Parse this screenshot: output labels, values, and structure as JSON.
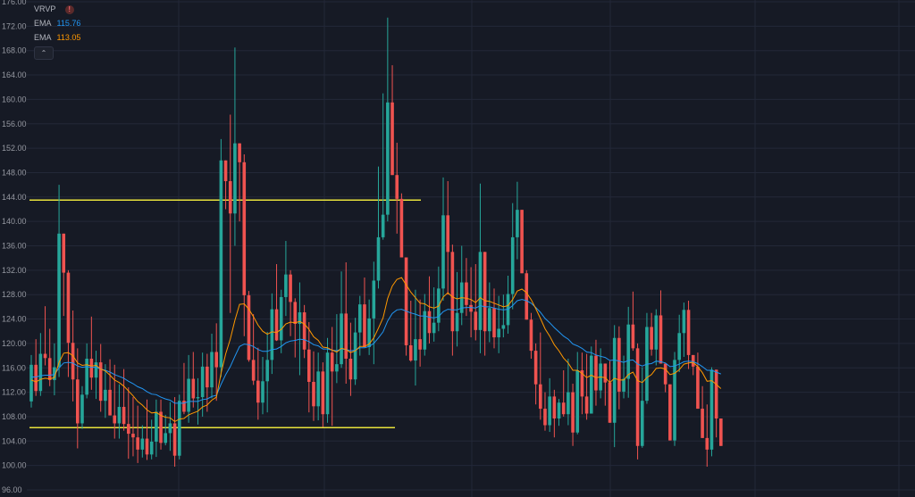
{
  "legend": {
    "vrvp_label": "VRVP",
    "warning_glyph": "!",
    "ema1_label": "EMA",
    "ema1_value": "115.76",
    "ema1_color": "#2196f3",
    "ema2_label": "EMA",
    "ema2_value": "113.05",
    "ema2_color": "#ff9800",
    "collapse_glyph": "⌃"
  },
  "colors": {
    "background": "#161a25",
    "grid": "#232838",
    "up": "#26a69a",
    "down": "#ef5350",
    "level_lines": "#e8e23c",
    "axis_text": "#9598a1"
  },
  "chart_data": {
    "type": "candlestick",
    "title": "",
    "ylim": [
      96,
      176
    ],
    "yticks": [
      96.0,
      100.0,
      104.0,
      108.0,
      112.0,
      116.0,
      120.0,
      124.0,
      128.0,
      132.0,
      136.0,
      140.0,
      144.0,
      148.0,
      152.0,
      156.0,
      160.0,
      164.0,
      168.0,
      172.0,
      176.0
    ],
    "grid": true,
    "levels": [
      143.5,
      106.2
    ],
    "ohlc": [
      [
        110.5,
        118.1,
        109.5,
        116.5
      ],
      [
        116.5,
        120.7,
        111.4,
        112.2
      ],
      [
        112.2,
        121.7,
        111.4,
        118.3
      ],
      [
        118.3,
        126.1,
        116.4,
        117.6
      ],
      [
        117.6,
        122.4,
        113.0,
        114.0
      ],
      [
        114.0,
        120.0,
        111.5,
        116.1
      ],
      [
        116.1,
        146.0,
        114.5,
        138.0
      ],
      [
        138.0,
        136.2,
        124.5,
        131.6
      ],
      [
        131.6,
        132.0,
        114.5,
        120.1
      ],
      [
        120.1,
        125.4,
        110.5,
        114.1
      ],
      [
        114.1,
        119.2,
        102.8,
        106.9
      ],
      [
        106.9,
        113.0,
        106.0,
        111.6
      ],
      [
        111.6,
        120.0,
        111.0,
        117.5
      ],
      [
        117.5,
        124.4,
        112.4,
        114.4
      ],
      [
        114.4,
        118.8,
        110.9,
        116.9
      ],
      [
        116.9,
        119.9,
        108.8,
        110.6
      ],
      [
        110.6,
        116.6,
        107.8,
        112.4
      ],
      [
        112.4,
        117.4,
        108.2,
        108.2
      ],
      [
        108.2,
        116.5,
        104.4,
        106.9
      ],
      [
        106.9,
        113.3,
        104.4,
        109.6
      ],
      [
        109.6,
        115.8,
        105.7,
        106.8
      ],
      [
        106.8,
        112.8,
        101.1,
        105.2
      ],
      [
        105.2,
        111.2,
        101.5,
        104.6
      ],
      [
        104.6,
        109.8,
        100.4,
        102.6
      ],
      [
        102.6,
        106.6,
        101.3,
        104.4
      ],
      [
        104.4,
        110.8,
        100.9,
        101.8
      ],
      [
        101.8,
        107.5,
        101.0,
        103.9
      ],
      [
        103.9,
        110.8,
        101.4,
        108.8
      ],
      [
        108.8,
        110.8,
        102.6,
        103.7
      ],
      [
        103.7,
        108.3,
        103.3,
        105.3
      ],
      [
        105.3,
        110.4,
        102.4,
        106.9
      ],
      [
        106.9,
        111.2,
        99.8,
        101.6
      ],
      [
        101.6,
        111.6,
        101.0,
        110.6
      ],
      [
        110.6,
        116.8,
        108.4,
        108.8
      ],
      [
        108.8,
        118.1,
        107.0,
        114.2
      ],
      [
        114.2,
        118.6,
        109.5,
        111.0
      ],
      [
        111.0,
        114.3,
        106.7,
        111.2
      ],
      [
        111.2,
        118.5,
        108.0,
        116.2
      ],
      [
        116.2,
        118.3,
        108.8,
        112.8
      ],
      [
        112.8,
        121.6,
        111.0,
        118.6
      ],
      [
        118.6,
        123.3,
        110.6,
        116.1
      ],
      [
        116.1,
        153.5,
        114.5,
        150.0
      ],
      [
        150.0,
        148.8,
        142.0,
        146.6
      ],
      [
        146.6,
        157.5,
        125.0,
        141.3
      ],
      [
        141.3,
        168.5,
        136.0,
        152.8
      ],
      [
        152.8,
        152.1,
        140.0,
        149.7
      ],
      [
        149.7,
        151.0,
        121.2,
        127.9
      ],
      [
        127.9,
        128.6,
        117.0,
        117.3
      ],
      [
        117.3,
        124.8,
        113.2,
        113.9
      ],
      [
        113.9,
        119.3,
        107.5,
        110.3
      ],
      [
        110.3,
        117.8,
        108.4,
        113.8
      ],
      [
        113.8,
        121.9,
        108.7,
        117.3
      ],
      [
        117.3,
        128.2,
        115.0,
        125.6
      ],
      [
        125.6,
        133.0,
        120.4,
        120.5
      ],
      [
        120.5,
        128.8,
        118.4,
        127.6
      ],
      [
        127.6,
        136.8,
        124.5,
        131.3
      ],
      [
        131.3,
        132.0,
        121.2,
        126.8
      ],
      [
        126.8,
        127.4,
        117.7,
        123.2
      ],
      [
        123.2,
        130.0,
        114.8,
        125.1
      ],
      [
        125.1,
        126.3,
        117.6,
        119.0
      ],
      [
        119.0,
        123.5,
        108.7,
        113.7
      ],
      [
        113.7,
        118.7,
        107.3,
        109.7
      ],
      [
        109.7,
        118.5,
        107.4,
        115.4
      ],
      [
        115.4,
        116.9,
        106.3,
        108.4
      ],
      [
        108.4,
        120.9,
        107.0,
        118.5
      ],
      [
        118.5,
        122.7,
        106.5,
        115.4
      ],
      [
        115.4,
        124.8,
        113.5,
        116.6
      ],
      [
        116.6,
        131.8,
        116.0,
        124.9
      ],
      [
        124.9,
        133.3,
        113.4,
        117.5
      ],
      [
        117.5,
        123.4,
        111.4,
        114.1
      ],
      [
        114.1,
        124.2,
        113.2,
        121.8
      ],
      [
        121.8,
        127.8,
        118.0,
        126.4
      ],
      [
        126.4,
        130.8,
        121.2,
        119.4
      ],
      [
        119.4,
        127.2,
        118.1,
        124.1
      ],
      [
        124.1,
        133.4,
        116.6,
        130.3
      ],
      [
        130.3,
        149.0,
        129.0,
        137.4
      ],
      [
        137.4,
        161.0,
        137.0,
        141.1
      ],
      [
        141.1,
        173.4,
        140.0,
        159.5
      ],
      [
        159.5,
        165.6,
        147.8,
        147.6
      ],
      [
        147.6,
        152.9,
        138.0,
        143.7
      ],
      [
        143.7,
        144.6,
        135.7,
        134.1
      ],
      [
        134.1,
        133.7,
        118.0,
        119.7
      ],
      [
        119.7,
        127.0,
        117.0,
        117.2
      ],
      [
        117.2,
        128.8,
        113.1,
        120.7
      ],
      [
        120.7,
        127.2,
        116.2,
        119.0
      ],
      [
        119.0,
        128.1,
        118.0,
        125.3
      ],
      [
        125.3,
        131.0,
        120.0,
        121.7
      ],
      [
        121.7,
        129.2,
        120.3,
        123.4
      ],
      [
        123.4,
        132.6,
        122.0,
        129.0
      ],
      [
        129.0,
        147.2,
        127.0,
        141.0
      ],
      [
        141.0,
        146.6,
        128.0,
        135.0
      ],
      [
        135.0,
        136.2,
        118.0,
        122.0
      ],
      [
        122.0,
        131.7,
        119.5,
        125.0
      ],
      [
        125.0,
        136.0,
        123.0,
        130.0
      ],
      [
        130.0,
        134.0,
        124.5,
        126.3
      ],
      [
        126.3,
        132.5,
        121.0,
        125.2
      ],
      [
        125.2,
        133.0,
        120.5,
        122.2
      ],
      [
        122.2,
        146.2,
        118.4,
        135.0
      ],
      [
        135.0,
        131.0,
        118.0,
        122.0
      ],
      [
        122.0,
        130.0,
        120.2,
        125.8
      ],
      [
        125.8,
        129.0,
        119.2,
        121.0
      ],
      [
        121.0,
        127.8,
        118.4,
        122.4
      ],
      [
        122.4,
        128.0,
        121.0,
        123.0
      ],
      [
        123.0,
        131.1,
        121.6,
        128.1
      ],
      [
        128.1,
        143.0,
        125.6,
        137.4
      ],
      [
        137.4,
        146.5,
        133.8,
        141.9
      ],
      [
        141.9,
        141.3,
        136.1,
        131.5
      ],
      [
        131.5,
        132.0,
        124.0,
        123.9
      ],
      [
        123.9,
        125.0,
        117.5,
        118.8
      ],
      [
        118.8,
        120.0,
        110.0,
        113.3
      ],
      [
        113.3,
        121.8,
        107.5,
        109.3
      ],
      [
        109.3,
        112.0,
        105.7,
        106.6
      ],
      [
        106.6,
        114.3,
        105.5,
        111.3
      ],
      [
        111.3,
        112.4,
        104.6,
        107.7
      ],
      [
        107.7,
        110.9,
        106.5,
        110.3
      ],
      [
        110.3,
        115.6,
        108.0,
        108.4
      ],
      [
        108.4,
        117.5,
        106.6,
        112.0
      ],
      [
        112.0,
        113.4,
        103.2,
        105.4
      ],
      [
        105.4,
        118.6,
        105.1,
        115.6
      ],
      [
        115.6,
        118.5,
        108.4,
        111.3
      ],
      [
        111.3,
        118.3,
        107.5,
        108.5
      ],
      [
        108.5,
        119.5,
        108.5,
        118.0
      ],
      [
        118.0,
        120.6,
        109.8,
        112.3
      ],
      [
        112.3,
        119.2,
        111.0,
        116.7
      ],
      [
        116.7,
        116.4,
        109.8,
        113.6
      ],
      [
        113.6,
        117.1,
        108.0,
        107.0
      ],
      [
        107.0,
        123.0,
        103.0,
        120.9
      ],
      [
        120.9,
        122.8,
        109.2,
        112.1
      ],
      [
        112.1,
        118.0,
        111.0,
        114.2
      ],
      [
        114.2,
        126.0,
        111.1,
        123.1
      ],
      [
        123.1,
        128.5,
        118.8,
        119.2
      ],
      [
        119.2,
        120.0,
        101.0,
        103.2
      ],
      [
        103.2,
        116.1,
        102.9,
        110.6
      ],
      [
        110.6,
        125.0,
        110.1,
        122.7
      ],
      [
        122.7,
        125.0,
        118.0,
        119.0
      ],
      [
        119.0,
        125.6,
        116.4,
        124.6
      ],
      [
        124.6,
        128.7,
        117.7,
        116.7
      ],
      [
        116.7,
        115.3,
        112.0,
        113.3
      ],
      [
        113.3,
        113.2,
        105.0,
        104.1
      ],
      [
        104.1,
        118.6,
        103.2,
        117.3
      ],
      [
        117.3,
        124.7,
        115.3,
        121.7
      ],
      [
        121.7,
        126.7,
        117.8,
        125.5
      ],
      [
        125.5,
        127.0,
        115.8,
        118.1
      ],
      [
        118.1,
        117.5,
        114.8,
        116.2
      ],
      [
        116.2,
        118.5,
        110.6,
        109.3
      ],
      [
        109.3,
        113.0,
        105.6,
        104.5
      ],
      [
        104.5,
        110.0,
        99.8,
        102.6
      ],
      [
        102.6,
        116.1,
        101.5,
        115.7
      ],
      [
        115.7,
        111.2,
        104.6,
        107.7
      ],
      [
        107.7,
        106.6,
        103.2,
        103.2
      ]
    ],
    "ema_series": [
      {
        "name": "EMA",
        "values": [
          114.5,
          114.5,
          114.7,
          114.8,
          114.8,
          114.9,
          116.0,
          116.8,
          116.9,
          116.8,
          116.3,
          116.1,
          116.2,
          116.1,
          116.1,
          115.8,
          115.6,
          115.3,
          114.9,
          114.6,
          114.3,
          113.8,
          113.4,
          112.9,
          112.6,
          112.1,
          111.7,
          111.6,
          111.2,
          110.9,
          110.7,
          110.2,
          110.2,
          110.2,
          110.5,
          110.5,
          110.5,
          110.8,
          110.9,
          111.3,
          111.5,
          113.3,
          114.9,
          116.2,
          117.9,
          119.5,
          119.9,
          119.8,
          119.5,
          119.0,
          118.7,
          118.7,
          119.0,
          119.1,
          119.5,
          120.1,
          120.4,
          120.5,
          120.7,
          120.6,
          120.3,
          119.8,
          119.6,
          119.1,
          119.1,
          118.9,
          118.8,
          119.1,
          119.0,
          118.8,
          118.9,
          119.3,
          119.3,
          119.5,
          120.0,
          120.9,
          121.9,
          123.7,
          124.9,
          125.5,
          125.6,
          125.3,
          125.0,
          124.8,
          124.5,
          124.5,
          124.3,
          124.2,
          124.4,
          125.2,
          125.6,
          125.5,
          125.5,
          125.8,
          125.9,
          125.9,
          125.8,
          126.2,
          126.0,
          126.0,
          125.8,
          125.6,
          125.5,
          125.6,
          126.2,
          127.0,
          127.2,
          127.0,
          126.6,
          125.9,
          125.1,
          124.1,
          123.4,
          122.6,
          121.9,
          121.2,
          120.7,
          119.9,
          119.6,
          119.2,
          118.6,
          118.5,
          118.1,
          117.9,
          117.7,
          117.2,
          117.3,
          117.1,
          116.9,
          117.2,
          117.3,
          116.6,
          116.3,
          116.6,
          116.7,
          117.1,
          117.0,
          116.8,
          116.2,
          116.3,
          116.6,
          117.0,
          117.1,
          117.0,
          116.7,
          116.2,
          115.6,
          115.6,
          115.3,
          115.0
        ]
      },
      {
        "name": "EMA",
        "values": [
          114.0,
          113.7,
          114.1,
          114.3,
          114.2,
          114.4,
          116.9,
          118.4,
          118.5,
          118.0,
          116.8,
          116.4,
          116.5,
          116.3,
          116.4,
          115.8,
          115.5,
          114.8,
          114.0,
          113.6,
          113.0,
          112.2,
          111.4,
          110.5,
          109.9,
          109.1,
          108.6,
          108.7,
          108.2,
          107.9,
          107.8,
          107.2,
          107.6,
          107.7,
          108.3,
          108.6,
          108.9,
          109.6,
          109.9,
          110.7,
          111.2,
          115.1,
          118.3,
          120.7,
          123.8,
          126.4,
          126.5,
          125.6,
          124.4,
          123.0,
          122.0,
          121.5,
          121.9,
          121.8,
          122.3,
          123.2,
          123.5,
          123.4,
          123.6,
          123.2,
          122.3,
          121.1,
          120.5,
          119.4,
          119.3,
          118.9,
          118.6,
          119.2,
          119.0,
          118.5,
          118.8,
          119.5,
          119.5,
          119.9,
          120.9,
          122.5,
          124.2,
          127.4,
          129.4,
          130.5,
          130.8,
          129.6,
          128.4,
          127.5,
          126.6,
          126.5,
          126.0,
          125.8,
          126.1,
          127.6,
          128.3,
          127.6,
          127.3,
          127.5,
          127.4,
          127.2,
          126.7,
          127.5,
          127.0,
          126.9,
          126.6,
          126.3,
          126.0,
          126.2,
          127.2,
          128.6,
          128.9,
          128.3,
          127.2,
          125.7,
          124.1,
          122.4,
          121.2,
          119.8,
          118.8,
          117.6,
          116.8,
          115.6,
          115.6,
          115.1,
          114.4,
          114.8,
          114.4,
          114.5,
          114.4,
          113.6,
          114.3,
          114.0,
          114.0,
          114.9,
          115.3,
          113.9,
          113.6,
          114.4,
          114.9,
          115.9,
          116.0,
          115.8,
          114.9,
          115.1,
          115.7,
          116.6,
          116.8,
          116.9,
          116.2,
          115.2,
          113.8,
          113.9,
          113.3,
          112.6
        ]
      }
    ]
  }
}
